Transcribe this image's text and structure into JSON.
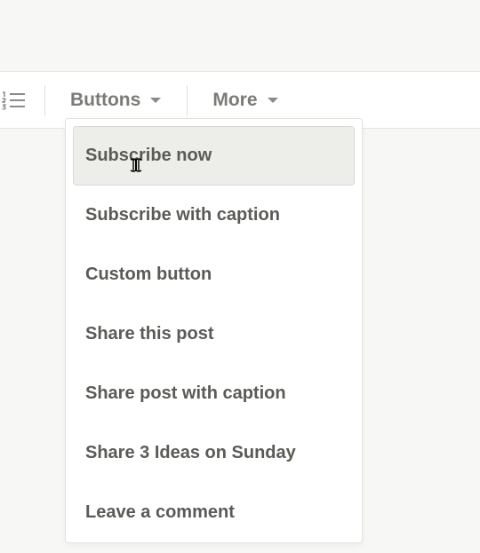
{
  "toolbar": {
    "buttons_label": "Buttons",
    "more_label": "More"
  },
  "dropdown": {
    "items": [
      {
        "label": "Subscribe now",
        "hovered": true
      },
      {
        "label": "Subscribe with caption",
        "hovered": false
      },
      {
        "label": "Custom button",
        "hovered": false
      },
      {
        "label": "Share this post",
        "hovered": false
      },
      {
        "label": "Share post with caption",
        "hovered": false
      },
      {
        "label": "Share 3 Ideas on Sunday",
        "hovered": false
      },
      {
        "label": "Leave a comment",
        "hovered": false
      }
    ]
  }
}
